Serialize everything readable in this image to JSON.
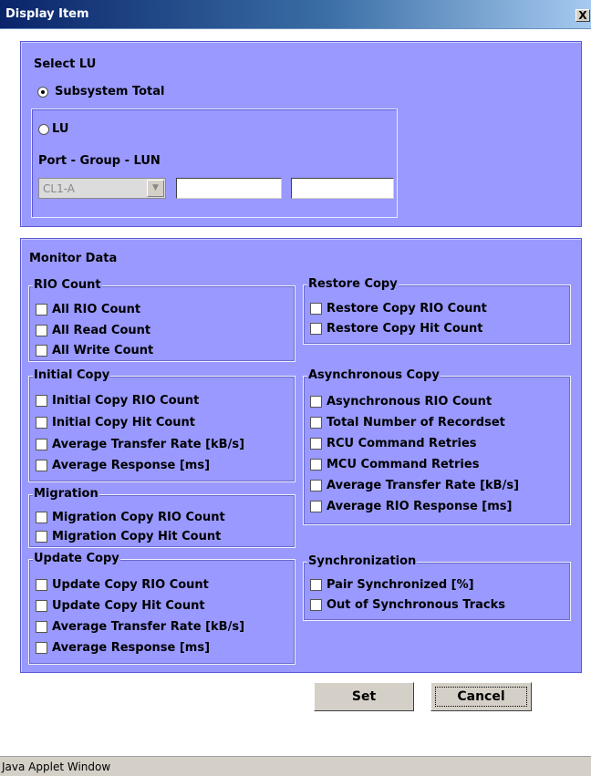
{
  "window": {
    "title": "Display Item",
    "close_glyph": "X",
    "status_text": "Java Applet Window"
  },
  "select_lu": {
    "heading": "Select LU",
    "subsystem_total_label": "Subsystem Total",
    "subsystem_total_selected": true,
    "lu_label": "LU",
    "lu_selected": false,
    "port_group_lun_label": "Port - Group - LUN",
    "port_select_value": "CL1-A",
    "group_value": "",
    "lun_value": ""
  },
  "monitor_data": {
    "heading": "Monitor Data",
    "rio_count": {
      "label": "RIO Count",
      "items": [
        "All RIO Count",
        "All Read Count",
        "All Write Count"
      ]
    },
    "initial_copy": {
      "label": "Initial Copy",
      "items": [
        "Initial Copy RIO Count",
        "Initial Copy Hit Count",
        "Average Transfer Rate [kB/s]",
        "Average Response [ms]"
      ]
    },
    "migration": {
      "label": "Migration",
      "items": [
        "Migration Copy RIO Count",
        "Migration Copy Hit Count"
      ]
    },
    "update_copy": {
      "label": "Update Copy",
      "items": [
        "Update Copy RIO Count",
        "Update Copy Hit Count",
        "Average Transfer Rate [kB/s]",
        "Average Response [ms]"
      ]
    },
    "restore_copy": {
      "label": "Restore Copy",
      "items": [
        "Restore Copy RIO Count",
        "Restore Copy Hit Count"
      ]
    },
    "asynchronous_copy": {
      "label": "Asynchronous Copy",
      "items": [
        "Asynchronous RIO Count",
        "Total Number of Recordset",
        "RCU Command Retries",
        "MCU Command Retries",
        "Average Transfer Rate [kB/s]",
        "Average RIO Response [ms]"
      ]
    },
    "synchronization": {
      "label": "Synchronization",
      "items": [
        "Pair Synchronized [%]",
        "Out of Synchronous Tracks"
      ]
    }
  },
  "buttons": {
    "set_label": "Set",
    "cancel_label": "Cancel"
  },
  "colors": {
    "panel": "#9999ff",
    "titlebar": "#0a246a"
  }
}
